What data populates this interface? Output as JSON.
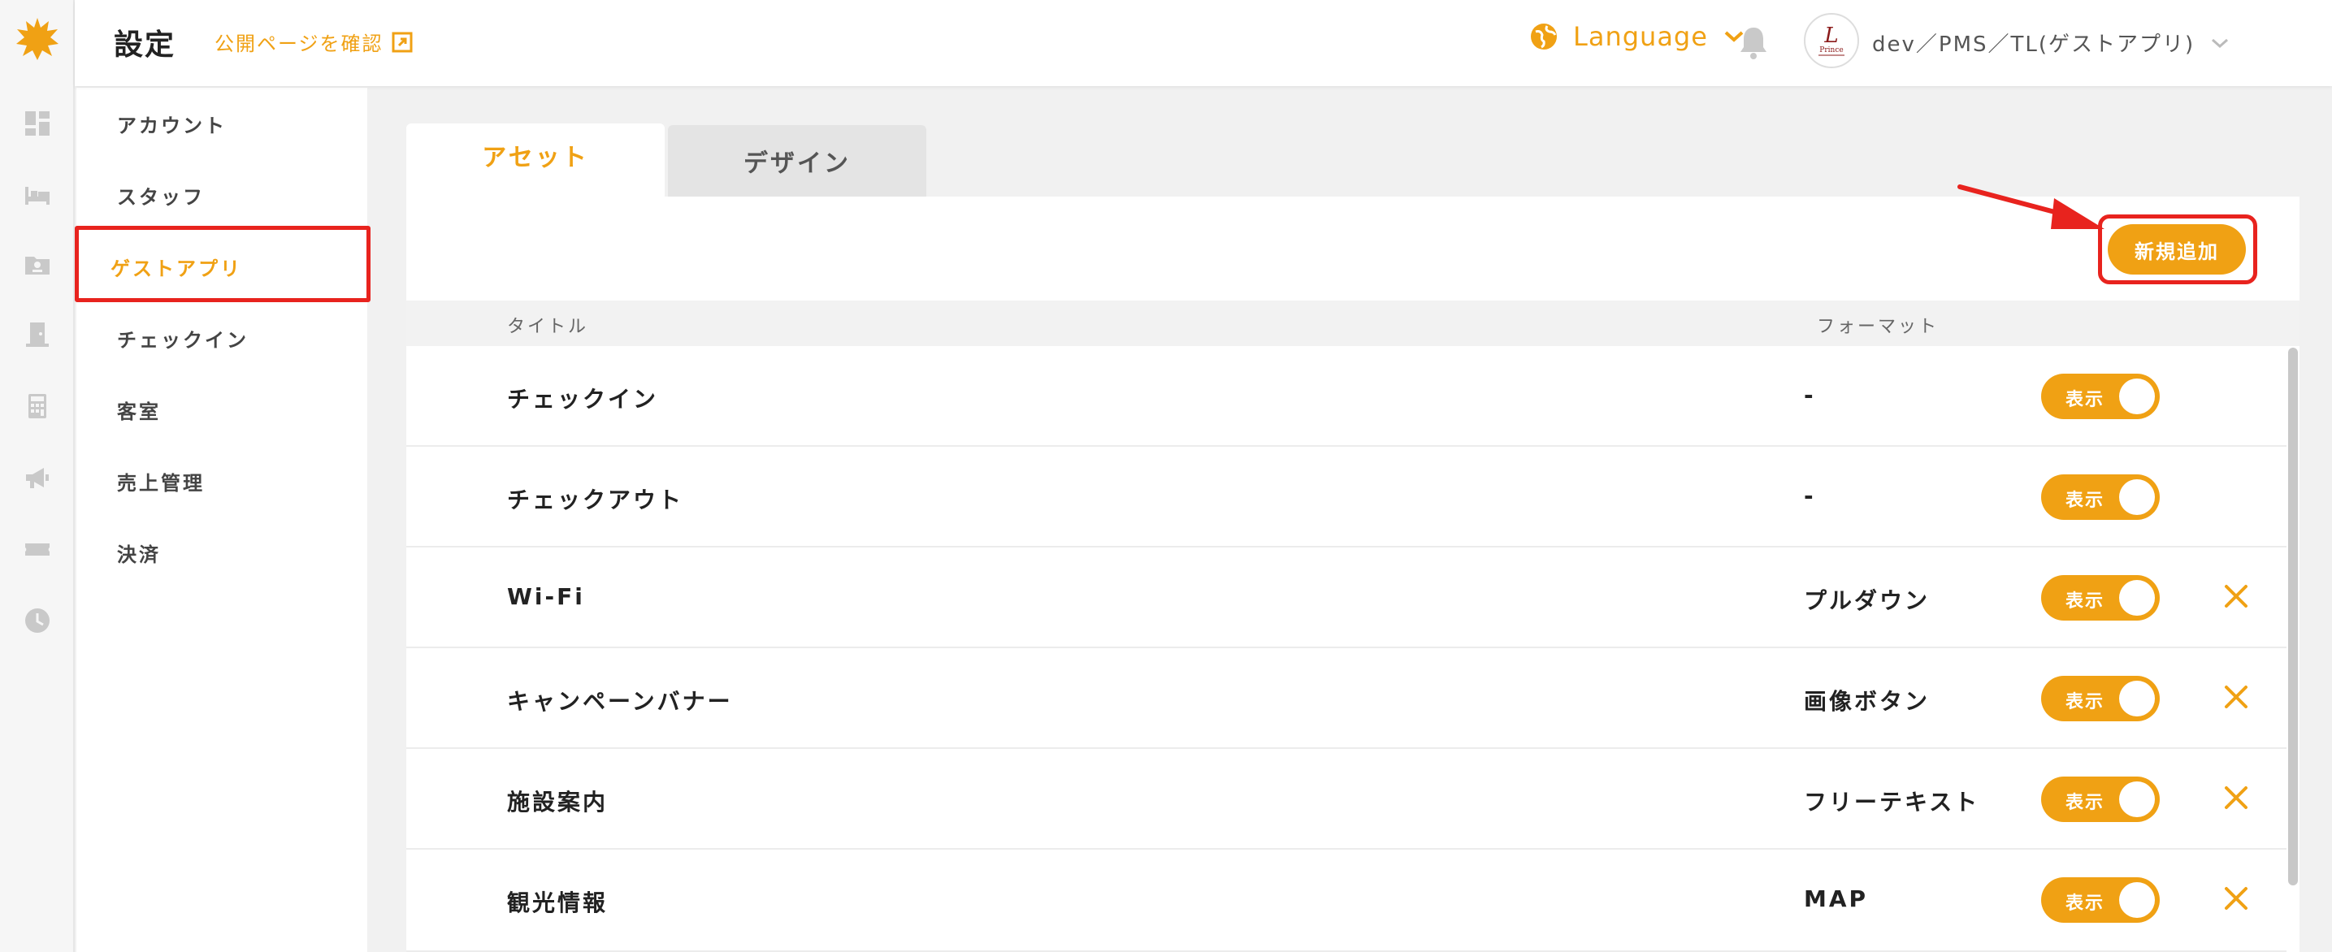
{
  "colors": {
    "accent": "#f0a114",
    "highlight": "#e8231e"
  },
  "rail": {
    "icons": [
      "dashboard-icon",
      "bed-icon",
      "guest-card-icon",
      "door-icon",
      "calculator-icon",
      "megaphone-icon",
      "ticket-icon",
      "clock-icon"
    ]
  },
  "header": {
    "title": "設定",
    "public_link": "公開ページを確認",
    "language": "Language",
    "user": "dev／PMS／TL(ゲストアプリ)"
  },
  "sidebar": {
    "items": [
      {
        "label": "アカウント"
      },
      {
        "label": "スタッフ"
      },
      {
        "label": "ゲストアプリ",
        "active": true
      },
      {
        "label": "チェックイン"
      },
      {
        "label": "客室"
      },
      {
        "label": "売上管理"
      },
      {
        "label": "決済"
      }
    ]
  },
  "tabs": [
    {
      "label": "アセット",
      "active": true
    },
    {
      "label": "デザイン",
      "active": false
    }
  ],
  "main": {
    "add_button": "新規追加",
    "columns": {
      "title": "タイトル",
      "format": "フォーマット"
    },
    "rows": [
      {
        "title": "チェックイン",
        "format": "-",
        "toggle": "表示",
        "deletable": false
      },
      {
        "title": "チェックアウト",
        "format": "-",
        "toggle": "表示",
        "deletable": false
      },
      {
        "title": "Wi-Fi",
        "format": "プルダウン",
        "toggle": "表示",
        "deletable": true
      },
      {
        "title": "キャンペーンバナー",
        "format": "画像ボタン",
        "toggle": "表示",
        "deletable": true
      },
      {
        "title": "施設案内",
        "format": "フリーテキスト",
        "toggle": "表示",
        "deletable": true
      },
      {
        "title": "観光情報",
        "format": "MAP",
        "toggle": "表示",
        "deletable": true
      }
    ]
  }
}
